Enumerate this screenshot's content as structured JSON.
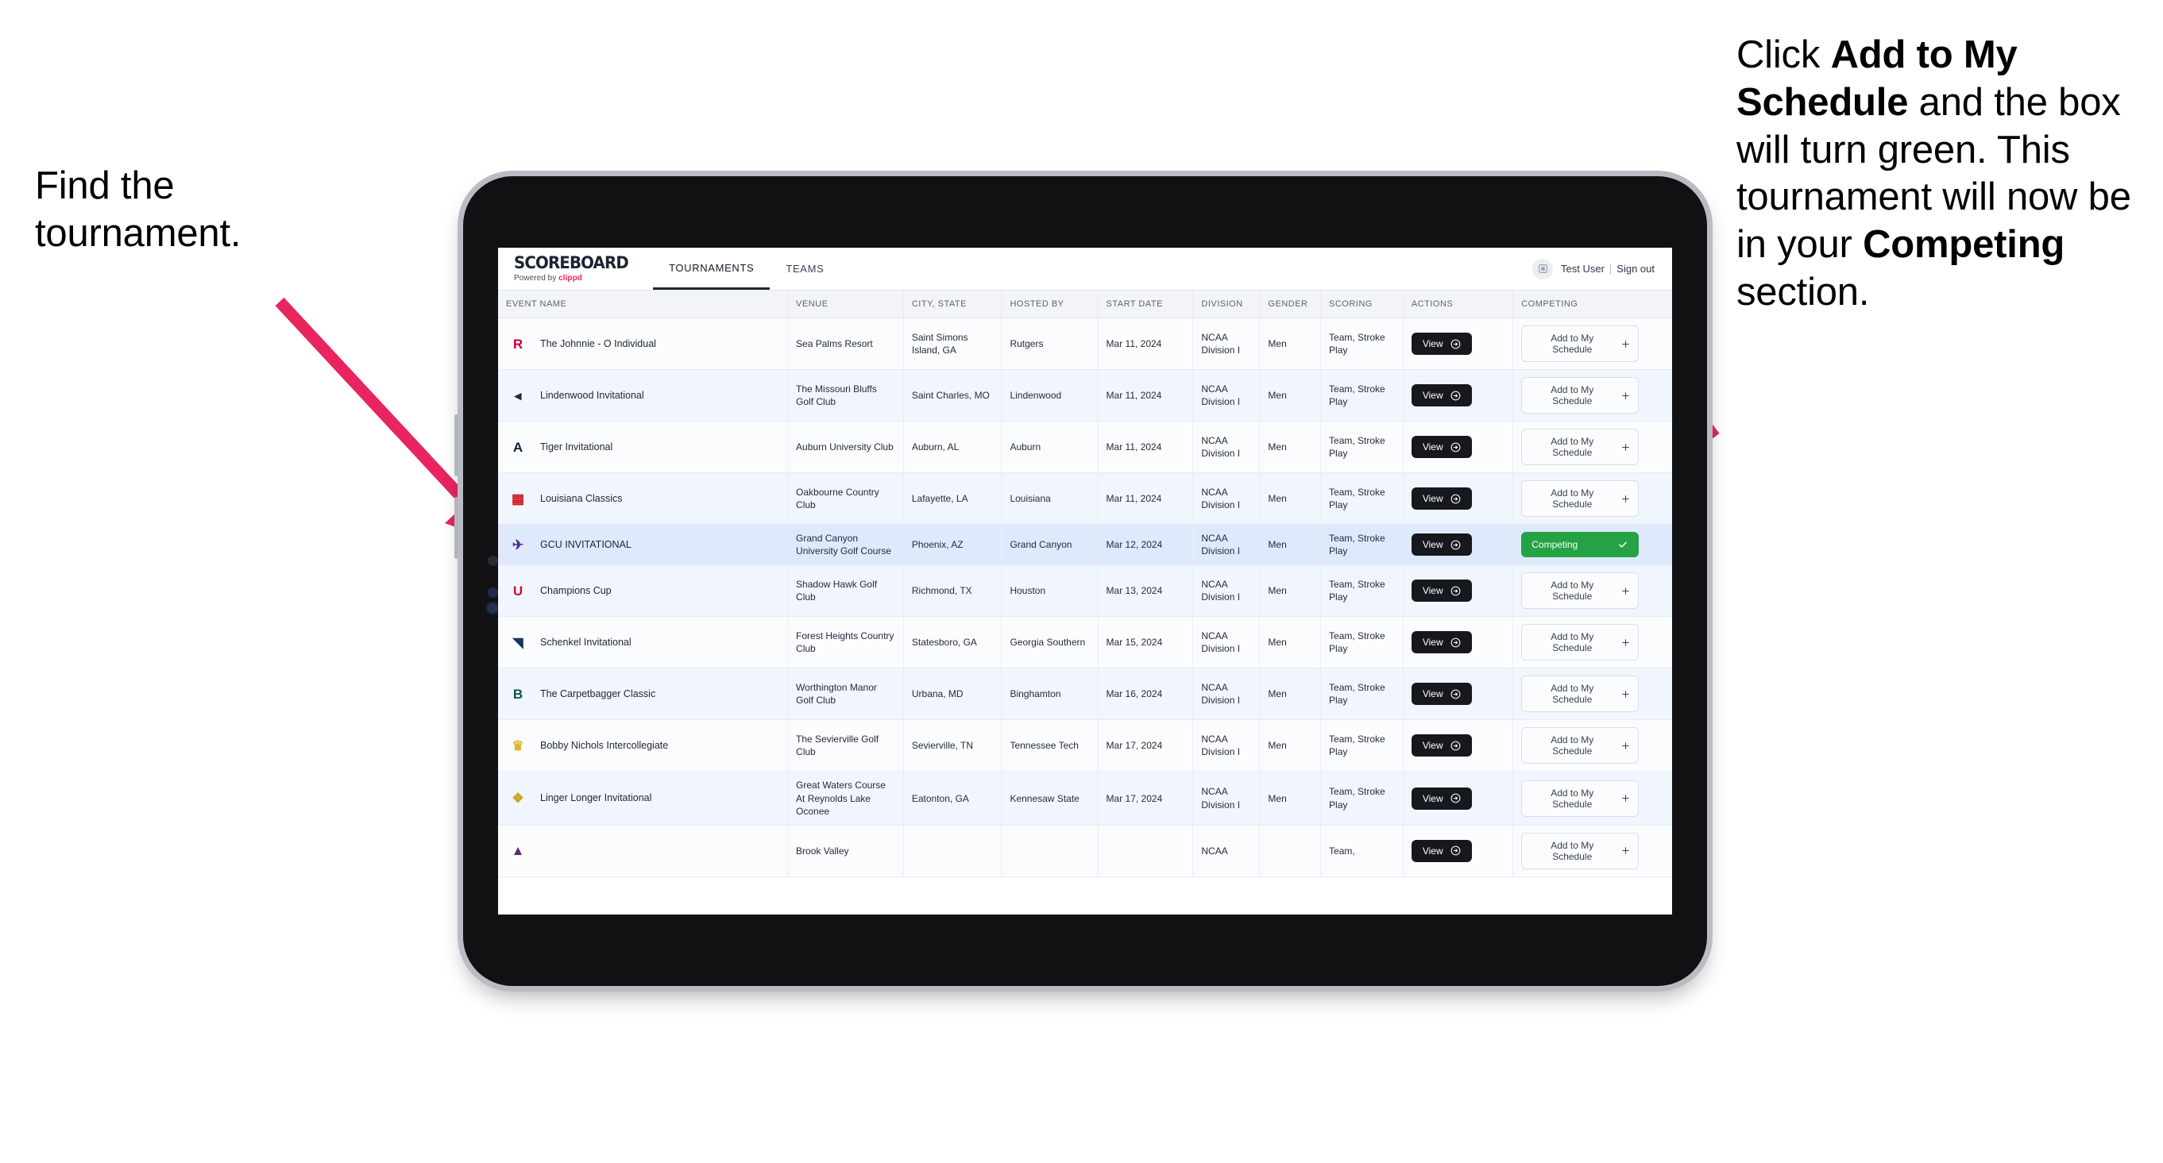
{
  "annotations": {
    "left": "Find the tournament.",
    "right_parts": [
      {
        "t": "Click ",
        "b": false
      },
      {
        "t": "Add to My Schedule",
        "b": true
      },
      {
        "t": " and the box will turn green. This tournament will now be in your ",
        "b": false
      },
      {
        "t": "Competing",
        "b": true
      },
      {
        "t": " section.",
        "b": false
      }
    ],
    "arrow_color": "#e8255f"
  },
  "app": {
    "brand": {
      "title": "SCOREBOARD",
      "powered_prefix": "Powered by ",
      "powered_brand": "clippd"
    },
    "tabs": [
      {
        "label": "TOURNAMENTS",
        "active": true
      },
      {
        "label": "TEAMS",
        "active": false
      }
    ],
    "user": {
      "avatar_icon": "user-avatar-icon",
      "name": "Test User",
      "separator": "|",
      "signout": "Sign out"
    }
  },
  "table": {
    "columns": [
      "EVENT NAME",
      "VENUE",
      "CITY, STATE",
      "HOSTED BY",
      "START DATE",
      "DIVISION",
      "GENDER",
      "SCORING",
      "ACTIONS",
      "COMPETING"
    ],
    "view_label": "View",
    "add_label": "Add to My Schedule",
    "add_icon": "plus-icon",
    "view_icon": "circle-arrow-right-icon",
    "competing_label": "Competing",
    "competing_icon": "check-icon",
    "competing_color": "#25a244",
    "rows": [
      {
        "logo": "R",
        "logo_color": "#cc0033",
        "event": "The Johnnie - O Individual",
        "venue": "Sea Palms Resort",
        "city": "Saint Simons Island, GA",
        "host": "Rutgers",
        "date": "Mar 11, 2024",
        "division": "NCAA Division I",
        "gender": "Men",
        "scoring": "Team, Stroke Play",
        "competing": false
      },
      {
        "logo": "◂",
        "logo_color": "#2b2b2b",
        "event": "Lindenwood Invitational",
        "venue": "The Missouri Bluffs Golf Club",
        "city": "Saint Charles, MO",
        "host": "Lindenwood",
        "date": "Mar 11, 2024",
        "division": "NCAA Division I",
        "gender": "Men",
        "scoring": "Team, Stroke Play",
        "competing": false
      },
      {
        "logo": "A",
        "logo_color": "#0c2340",
        "event": "Tiger Invitational",
        "venue": "Auburn University Club",
        "city": "Auburn, AL",
        "host": "Auburn",
        "date": "Mar 11, 2024",
        "division": "NCAA Division I",
        "gender": "Men",
        "scoring": "Team, Stroke Play",
        "competing": false
      },
      {
        "logo": "▦",
        "logo_color": "#ce181e",
        "event": "Louisiana Classics",
        "venue": "Oakbourne Country Club",
        "city": "Lafayette, LA",
        "host": "Louisiana",
        "date": "Mar 11, 2024",
        "division": "NCAA Division I",
        "gender": "Men",
        "scoring": "Team, Stroke Play",
        "competing": false
      },
      {
        "logo": "✈",
        "logo_color": "#4f2d8f",
        "event": "GCU INVITATIONAL",
        "venue": "Grand Canyon University Golf Course",
        "city": "Phoenix, AZ",
        "host": "Grand Canyon",
        "date": "Mar 12, 2024",
        "division": "NCAA Division I",
        "gender": "Men",
        "scoring": "Team, Stroke Play",
        "competing": true
      },
      {
        "logo": "U",
        "logo_color": "#c8102e",
        "event": "Champions Cup",
        "venue": "Shadow Hawk Golf Club",
        "city": "Richmond, TX",
        "host": "Houston",
        "date": "Mar 13, 2024",
        "division": "NCAA Division I",
        "gender": "Men",
        "scoring": "Team, Stroke Play",
        "competing": false
      },
      {
        "logo": "◥",
        "logo_color": "#15365f",
        "event": "Schenkel Invitational",
        "venue": "Forest Heights Country Club",
        "city": "Statesboro, GA",
        "host": "Georgia Southern",
        "date": "Mar 15, 2024",
        "division": "NCAA Division I",
        "gender": "Men",
        "scoring": "Team, Stroke Play",
        "competing": false
      },
      {
        "logo": "B",
        "logo_color": "#0d5257",
        "event": "The Carpetbagger Classic",
        "venue": "Worthington Manor Golf Club",
        "city": "Urbana, MD",
        "host": "Binghamton",
        "date": "Mar 16, 2024",
        "division": "NCAA Division I",
        "gender": "Men",
        "scoring": "Team, Stroke Play",
        "competing": false
      },
      {
        "logo": "♛",
        "logo_color": "#e0b425",
        "event": "Bobby Nichols Intercollegiate",
        "venue": "The Sevierville Golf Club",
        "city": "Sevierville, TN",
        "host": "Tennessee Tech",
        "date": "Mar 17, 2024",
        "division": "NCAA Division I",
        "gender": "Men",
        "scoring": "Team, Stroke Play",
        "competing": false
      },
      {
        "logo": "❖",
        "logo_color": "#c8a42c",
        "event": "Linger Longer Invitational",
        "venue": "Great Waters Course At Reynolds Lake Oconee",
        "city": "Eatonton, GA",
        "host": "Kennesaw State",
        "date": "Mar 17, 2024",
        "division": "NCAA Division I",
        "gender": "Men",
        "scoring": "Team, Stroke Play",
        "competing": false
      },
      {
        "logo": "▲",
        "logo_color": "#5b2d6e",
        "event": "",
        "venue": "Brook Valley",
        "city": "",
        "host": "",
        "date": "",
        "division": "NCAA",
        "gender": "",
        "scoring": "Team,",
        "competing": false
      }
    ]
  }
}
